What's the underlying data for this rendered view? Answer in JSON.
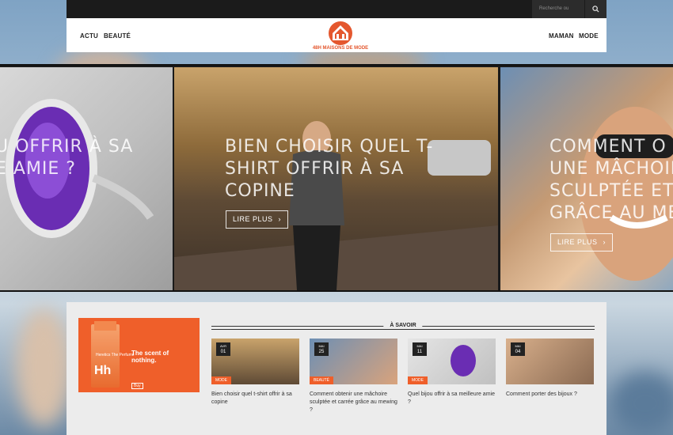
{
  "topbar": {
    "search_placeholder": "Recherche ou"
  },
  "header": {
    "nav_left": [
      "ACTU",
      "BEAUTÉ"
    ],
    "nav_right": [
      "MAMAN",
      "MODE"
    ],
    "logo_text": "48H MAISONS DE MODE"
  },
  "slider": {
    "left_title": "U OFFRIR À SA\nE AMIE ?",
    "center_title": "BIEN CHOISIR QUEL T-\nSHIRT OFFRIR À SA\nCOPINE",
    "center_button": "LIRE PLUS",
    "right_title": "COMMENT O\nUNE MÂCHOIRE\nSCULPTÉE ET\nGRÂCE AU ME",
    "right_button": "LIRE PLUS"
  },
  "ad": {
    "tagline": "The scent of nothing.",
    "brand": "Hh",
    "product_line": "Heretics The Perfume",
    "cta": "Buy"
  },
  "section": {
    "title": "À SAVOIR"
  },
  "cards": [
    {
      "month": "AVR",
      "day": "01",
      "category": "MODE",
      "title": "Bien choisir quel t-shirt offrir à sa copine"
    },
    {
      "month": "MAI",
      "day": "25",
      "category": "BEAUTÉ",
      "title": "Comment obtenir une mâchoire sculptée et carrée grâce au mewing ?"
    },
    {
      "month": "MAI",
      "day": "11",
      "category": "MODE",
      "title": "Quel bijou offrir à sa meilleure amie ?"
    },
    {
      "month": "MAI",
      "day": "04",
      "category": "",
      "title": "Comment porter des bijoux ?"
    }
  ],
  "colors": {
    "accent": "#ef5f2a",
    "dark": "#1b1b1b"
  }
}
